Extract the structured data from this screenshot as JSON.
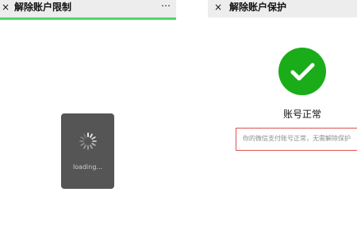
{
  "left_screen": {
    "close_icon": "close-icon",
    "title": "解除账户限制",
    "more_icon": "⋯",
    "progress_color": "#4cd964",
    "loading_text": "loading..."
  },
  "right_screen": {
    "close_icon": "close-icon",
    "title": "解除账户保护",
    "status": "账号正常",
    "notice": "你的微信支付账号正常，无需解除保护",
    "success_color": "#1aad19",
    "notice_border_color": "#d9534f"
  }
}
